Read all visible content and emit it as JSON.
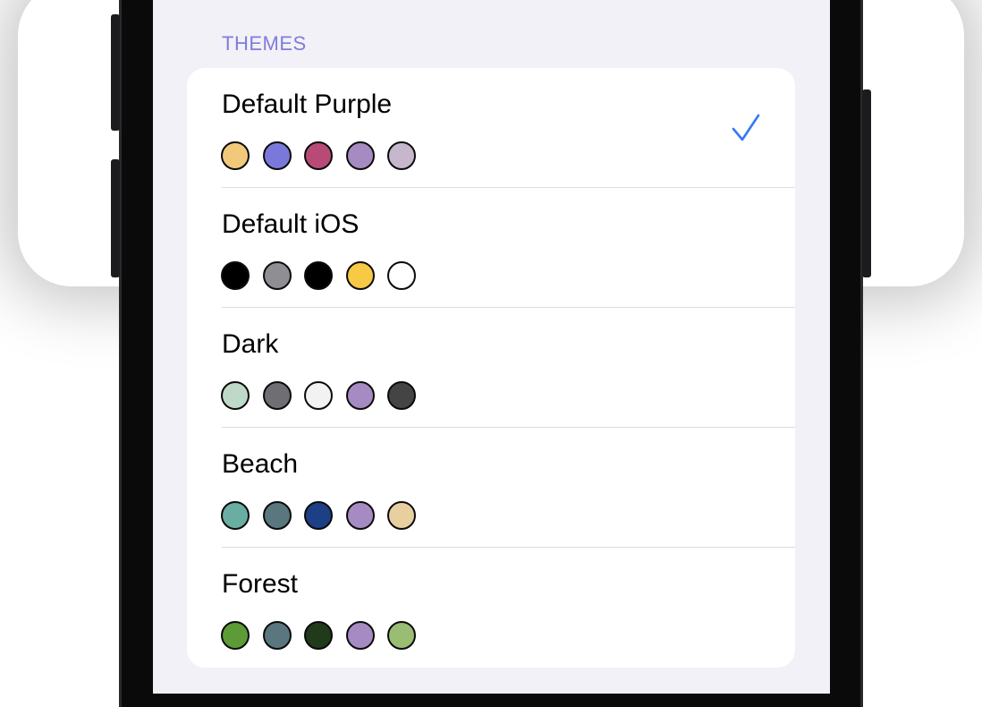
{
  "section": {
    "header": "THEMES"
  },
  "colors": {
    "accent": "#7f7dd8",
    "checkmark": "#3478f6",
    "screen_bg": "#f2f1f7",
    "card_bg": "#ffffff"
  },
  "themes": [
    {
      "name": "Default Purple",
      "selected": true,
      "swatches": [
        "#f2c97a",
        "#7b78db",
        "#b84a77",
        "#a68bc2",
        "#c6b7cc"
      ]
    },
    {
      "name": "Default iOS",
      "selected": false,
      "swatches": [
        "#000000",
        "#8e8e93",
        "#000000",
        "#f7c944",
        "#ffffff"
      ]
    },
    {
      "name": "Dark",
      "selected": false,
      "swatches": [
        "#bfd9c8",
        "#6e6e73",
        "#f2f2f2",
        "#a68bc2",
        "#444444"
      ]
    },
    {
      "name": "Beach",
      "selected": false,
      "swatches": [
        "#6aaea3",
        "#5a7780",
        "#1d3f86",
        "#a68bc2",
        "#e8cfa0"
      ]
    },
    {
      "name": "Forest",
      "selected": false,
      "swatches": [
        "#5c9b36",
        "#5a7780",
        "#213a1a",
        "#a68bc2",
        "#98bd73"
      ]
    }
  ],
  "icons": {
    "selected_indicator": "checkmark-icon"
  }
}
